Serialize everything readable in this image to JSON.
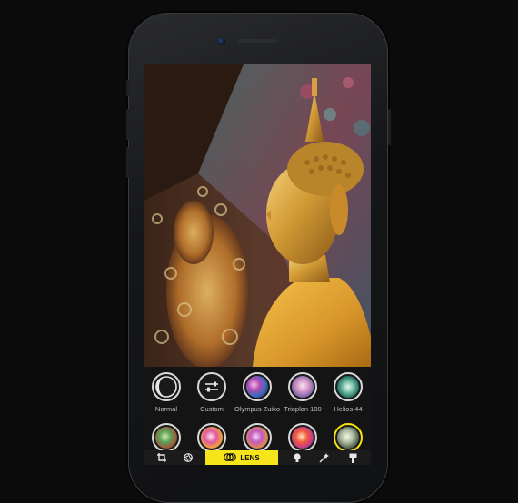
{
  "lenses_row1": [
    {
      "name": "Normal",
      "icon": "circle-half-icon",
      "selected": false
    },
    {
      "name": "Custom",
      "icon": "sliders-icon",
      "selected": false
    },
    {
      "name": "Olympus Zuiko",
      "icon": "lens-orb-icon",
      "selected": false
    },
    {
      "name": "Trioplan 100",
      "icon": "lens-orb-icon",
      "selected": false
    },
    {
      "name": "Helios 44",
      "icon": "lens-orb-icon",
      "selected": false
    }
  ],
  "lenses_row2": [
    {
      "icon": "lens-orb-icon",
      "selected": false
    },
    {
      "icon": "lens-orb-icon",
      "selected": false
    },
    {
      "icon": "lens-orb-icon",
      "selected": false
    },
    {
      "icon": "lens-orb-icon",
      "selected": false
    },
    {
      "icon": "lens-orb-icon",
      "selected": true
    }
  ],
  "toolbar": {
    "lens_label": "LENS",
    "items": [
      "crop-icon",
      "aperture-icon",
      "lens-icon",
      "lightbulb-icon",
      "magic-wand-icon",
      "brush-icon"
    ]
  },
  "colors": {
    "accent": "#f6e51a",
    "panel": "#141415",
    "label": "#bdbdbd"
  }
}
